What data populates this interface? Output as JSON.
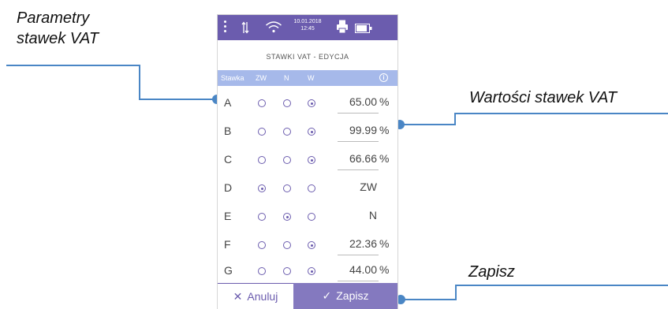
{
  "callouts": {
    "parameters_line1": "Parametry",
    "parameters_line2": "stawek VAT",
    "values": "Wartości stawek VAT",
    "save": "Zapisz"
  },
  "status": {
    "date": "10.01.2018",
    "time": "12:45",
    "icons": [
      "menu-icon",
      "transfer-icon",
      "wifi-icon",
      "printer-icon",
      "battery-icon"
    ]
  },
  "screen": {
    "title": "STAWKI VAT - EDYCJA",
    "columns": [
      "Stawka",
      "ZW",
      "N",
      "W"
    ],
    "rows": [
      {
        "label": "A",
        "value": "65.00",
        "unit": "%"
      },
      {
        "label": "B",
        "value": "99.99",
        "unit": "%"
      },
      {
        "label": "C",
        "value": "66.66",
        "unit": "%"
      },
      {
        "label": "D",
        "value": "ZW",
        "unit": ""
      },
      {
        "label": "E",
        "value": "N",
        "unit": ""
      },
      {
        "label": "F",
        "value": "22.36",
        "unit": "%"
      },
      {
        "label": "G",
        "value": "44.00",
        "unit": "%"
      }
    ],
    "cancel_label": "Anuluj",
    "save_label": "Zapisz"
  },
  "colors": {
    "accent": "#6b5cae",
    "header": "#a6b9ea",
    "save": "#8479bf",
    "leader": "#4a86c5"
  }
}
